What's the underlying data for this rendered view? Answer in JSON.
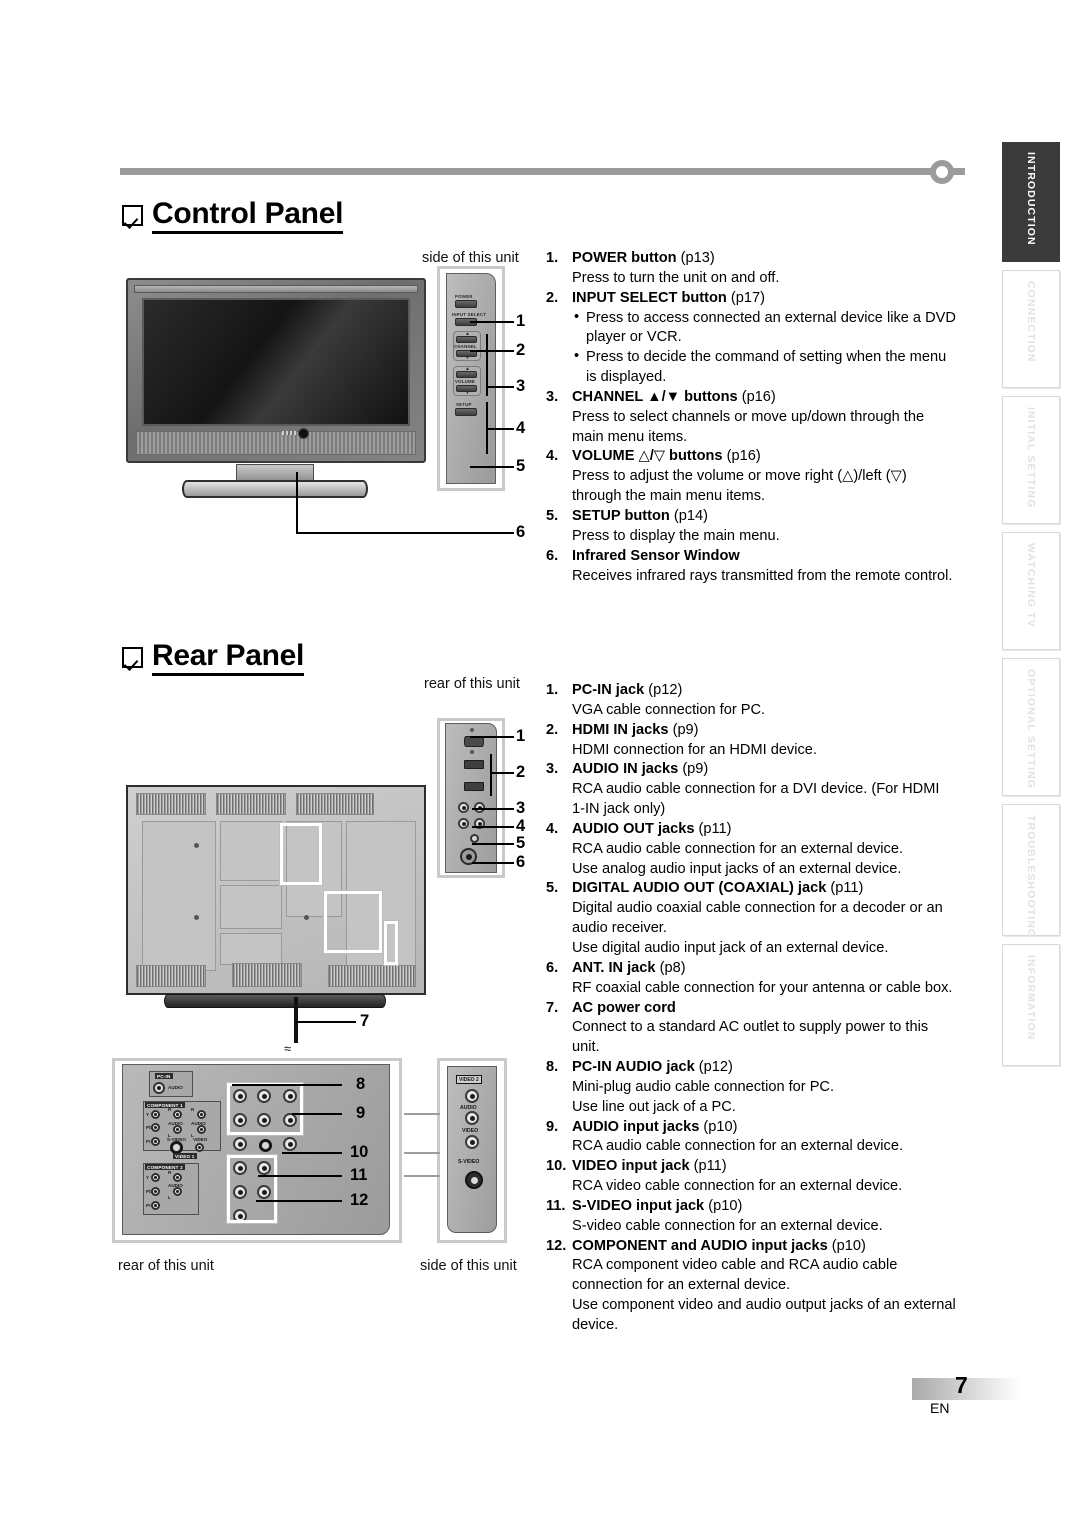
{
  "page": {
    "number": "7",
    "lang_code": "EN"
  },
  "sections": {
    "control_panel": {
      "heading": "Control Panel",
      "caption_side": "side of this unit",
      "items": [
        {
          "num": "1.",
          "title": "POWER button",
          "page": "(p13)",
          "desc": [
            "Press to turn the unit on and off."
          ],
          "bullets": []
        },
        {
          "num": "2.",
          "title": "INPUT SELECT button",
          "page": "(p17)",
          "desc": [],
          "bullets": [
            "Press to access connected an external device like a DVD player or VCR.",
            "Press to decide the command of setting when the menu is displayed."
          ]
        },
        {
          "num": "3.",
          "title": "CHANNEL ▲/▼ buttons",
          "page": "(p16)",
          "desc": [
            "Press to select channels or move up/down through the main menu items."
          ],
          "bullets": []
        },
        {
          "num": "4.",
          "title": "VOLUME △/▽ buttons",
          "page": "(p16)",
          "desc": [
            "Press to adjust the volume or move right (△)/left (▽) through the main menu items."
          ],
          "bullets": []
        },
        {
          "num": "5.",
          "title": "SETUP button",
          "page": "(p14)",
          "desc": [
            "Press to display the main menu."
          ],
          "bullets": []
        },
        {
          "num": "6.",
          "title": "Infrared Sensor Window",
          "page": "",
          "desc": [
            "Receives infrared rays transmitted from the remote control."
          ],
          "bullets": []
        }
      ],
      "callouts": [
        "1",
        "2",
        "3",
        "4",
        "5",
        "6"
      ],
      "button_labels": {
        "power": "POWER",
        "input_select": "INPUT SELECT",
        "channel": "CHANNEL",
        "volume": "VOLUME",
        "setup": "SETUP"
      }
    },
    "rear_panel": {
      "heading": "Rear Panel",
      "caption_rear_top": "rear of this unit",
      "caption_rear_bottom": "rear of this unit",
      "caption_side_bottom": "side of this unit",
      "items": [
        {
          "num": "1.",
          "title": "PC-IN jack",
          "page": "(p12)",
          "desc": [
            "VGA cable connection for PC."
          ]
        },
        {
          "num": "2.",
          "title": "HDMI IN jacks",
          "page": "(p9)",
          "desc": [
            "HDMI connection for an HDMI device."
          ]
        },
        {
          "num": "3.",
          "title": "AUDIO IN jacks",
          "page": "(p9)",
          "desc": [
            "RCA audio cable connection for a DVI device. (For HDMI 1-IN jack only)"
          ]
        },
        {
          "num": "4.",
          "title": "AUDIO OUT jacks",
          "page": "(p11)",
          "desc": [
            "RCA audio cable connection for an external device.",
            "Use analog audio input jacks of an external device."
          ]
        },
        {
          "num": "5.",
          "title": "DIGITAL AUDIO OUT (COAXIAL) jack",
          "page": "(p11)",
          "desc": [
            "Digital audio coaxial cable connection for a decoder or an audio receiver.",
            "Use digital audio input jack of an external device."
          ]
        },
        {
          "num": "6.",
          "title": "ANT. IN jack",
          "page": "(p8)",
          "desc": [
            "RF coaxial cable connection for your antenna or cable box."
          ]
        },
        {
          "num": "7.",
          "title": "AC power cord",
          "page": "",
          "desc": [
            "Connect to a standard AC outlet to supply power to this unit."
          ]
        },
        {
          "num": "8.",
          "title": "PC-IN AUDIO jack",
          "page": "(p12)",
          "desc": [
            "Mini-plug audio cable connection for PC.",
            "Use line out jack of a PC."
          ]
        },
        {
          "num": "9.",
          "title": "AUDIO input jacks",
          "page": "(p10)",
          "desc": [
            "RCA audio cable connection for an external device."
          ]
        },
        {
          "num": "10.",
          "title": "VIDEO input jack",
          "page": "(p11)",
          "desc": [
            "RCA video cable connection for an external device."
          ]
        },
        {
          "num": "11.",
          "title": "S-VIDEO input jack",
          "page": "(p10)",
          "desc": [
            "S-video cable connection for an external device."
          ]
        },
        {
          "num": "12.",
          "title": "COMPONENT and AUDIO input jacks",
          "page": "(p10)",
          "desc": [
            "RCA component video cable and RCA audio cable connection for an external device.",
            "Use component video and audio output jacks of an external device."
          ]
        }
      ],
      "callouts_top": [
        "1",
        "2",
        "3",
        "4",
        "5",
        "6"
      ],
      "callout_cord": "7",
      "callouts_bottom": [
        "8",
        "9",
        "10",
        "11",
        "12"
      ],
      "jack_labels": {
        "pc_in": "PC-IN",
        "pc_in_audio": "AUDIO",
        "component1": "COMPONENT 1",
        "component2": "COMPONENT 2",
        "video1": "VIDEO 1",
        "video2": "VIDEO 2",
        "y": "Y",
        "pb": "Pb",
        "pr": "Pr",
        "audio": "AUDIO",
        "r": "R",
        "l": "L",
        "svideo": "S-VIDEO",
        "video": "VIDEO"
      }
    }
  },
  "tabs": [
    {
      "label": "INTRODUCTION",
      "active": true
    },
    {
      "label": "CONNECTION",
      "active": false
    },
    {
      "label": "INITIAL SETTING",
      "active": false
    },
    {
      "label": "WATCHING TV",
      "active": false
    },
    {
      "label": "OPTIONAL SETTING",
      "active": false
    },
    {
      "label": "TROUBLESHOOTING",
      "active": false
    },
    {
      "label": "INFORMATION",
      "active": false
    }
  ],
  "colors": {
    "rule": "#9b9b9b",
    "active_tab_bg": "#3b3b3b",
    "idle_tab_text": "#e2e2e2"
  }
}
